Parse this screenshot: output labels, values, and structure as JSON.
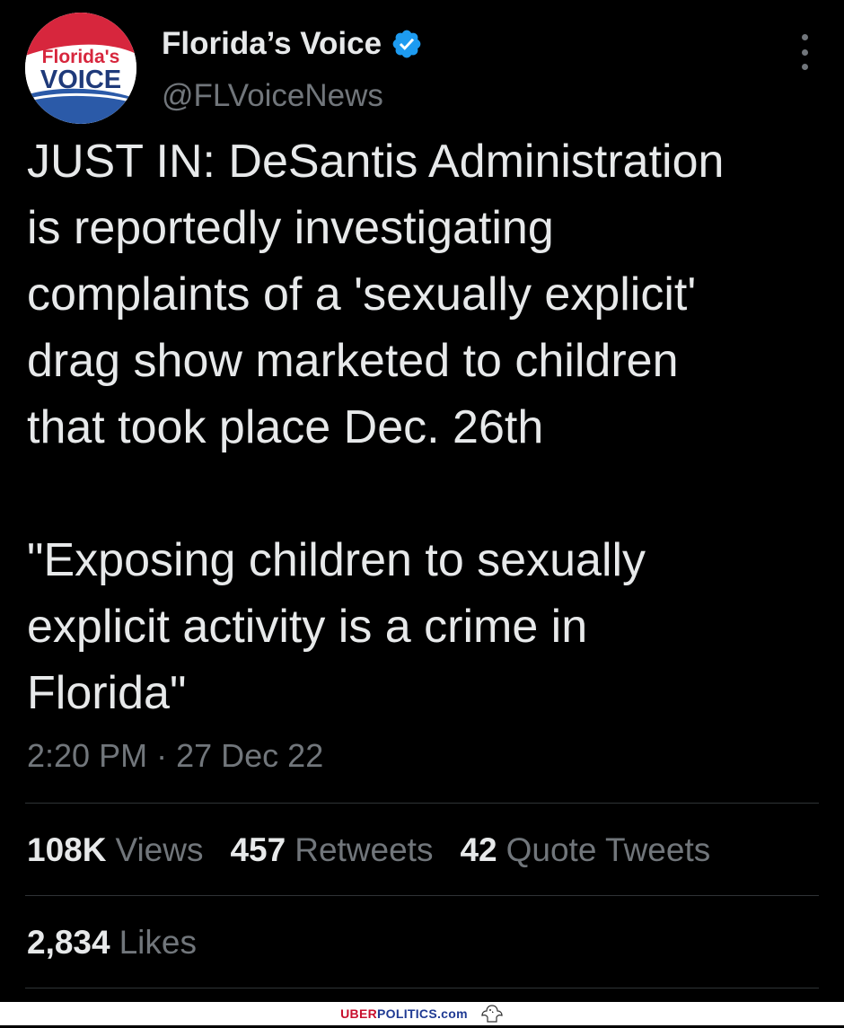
{
  "tweet": {
    "avatar": {
      "logo_line1": "Florida's",
      "logo_line2": "VOICE",
      "colors": {
        "red": "#d7263d",
        "blue": "#2b5aa8",
        "white": "#ffffff"
      }
    },
    "display_name": "Florida’s Voice",
    "handle": "@FLVoiceNews",
    "verified_icon": "verified-badge-icon",
    "more_icon": "more-options-icon",
    "text_lines": [
      "JUST IN: DeSantis Administration",
      "is reportedly investigating",
      "complaints of a 'sexually explicit'",
      "drag show marketed to children",
      "that took place Dec. 26th"
    ],
    "quote_lines": [
      "\"Exposing children to sexually",
      "explicit activity is a crime in",
      "Florida\""
    ],
    "time": "2:20 PM",
    "separator": "·",
    "date": "27 Dec 22",
    "stats": {
      "views": {
        "value": "108K",
        "label": "Views"
      },
      "retweets": {
        "value": "457",
        "label": "Retweets"
      },
      "quotes": {
        "value": "42",
        "label": "Quote Tweets"
      },
      "likes": {
        "value": "2,834",
        "label": "Likes"
      }
    }
  },
  "watermark": {
    "uber": "UBER",
    "politics": "POLITICS.com",
    "icon": "eagle-icon"
  },
  "colors": {
    "background": "#000000",
    "text_primary": "#e7e9ea",
    "text_secondary": "#71767b",
    "divider": "#2f3336",
    "verified": "#1d9bf0"
  }
}
